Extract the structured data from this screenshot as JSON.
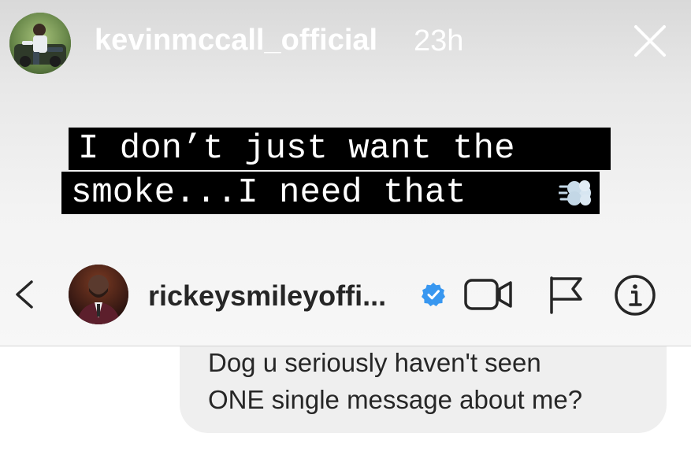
{
  "story": {
    "username": "kevinmccall_official",
    "timestamp": "23h",
    "caption_lines": [
      "I don’t just want the",
      "smoke...I need that"
    ],
    "caption_emoji": "dashing-away"
  },
  "chat_header": {
    "username": "rickeysmileyoffi...",
    "verified": true,
    "icons": [
      "back-icon",
      "verified-badge-icon",
      "video-call-icon",
      "flag-icon",
      "info-icon"
    ]
  },
  "messages": [
    {
      "lines": [
        "Dog u seriously haven't seen",
        "ONE single message about me?"
      ]
    }
  ],
  "colors": {
    "verified_blue": "#3897f0",
    "text_dark": "#262626",
    "bubble_bg": "#efefef",
    "caption_bg": "#000000"
  }
}
